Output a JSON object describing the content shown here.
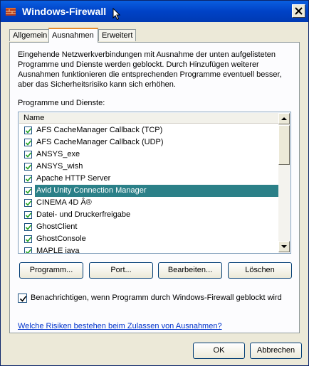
{
  "window": {
    "title": "Windows-Firewall"
  },
  "tabs": [
    {
      "label": "Allgemein"
    },
    {
      "label": "Ausnahmen",
      "active": true
    },
    {
      "label": "Erweitert"
    }
  ],
  "description": "Eingehende Netzwerkverbindungen mit Ausnahme der unten aufgelisteten Programme und Dienste werden geblockt. Durch Hinzufügen weiterer Ausnahmen funktionieren die entsprechenden Programme eventuell besser, aber das Sicherheitsrisiko kann sich erhöhen.",
  "list": {
    "label": "Programme und Dienste:",
    "column_header": "Name",
    "items": [
      {
        "name": "AFS CacheManager Callback (TCP)",
        "checked": true
      },
      {
        "name": "AFS CacheManager Callback (UDP)",
        "checked": true
      },
      {
        "name": "ANSYS_exe",
        "checked": true
      },
      {
        "name": "ANSYS_wish",
        "checked": true
      },
      {
        "name": "Apache HTTP Server",
        "checked": true
      },
      {
        "name": "Avid Unity Connection Manager",
        "checked": true,
        "selected": true
      },
      {
        "name": "CINEMA 4D Â®",
        "checked": true
      },
      {
        "name": "Datei- und Druckerfreigabe",
        "checked": true
      },
      {
        "name": "GhostClient",
        "checked": true
      },
      {
        "name": "GhostConsole",
        "checked": true
      },
      {
        "name": "MAPLE java",
        "checked": true
      }
    ]
  },
  "buttons": {
    "programm": "Programm...",
    "port": "Port...",
    "bearbeiten": "Bearbeiten...",
    "loeschen": "Löschen",
    "ok": "OK",
    "abbrechen": "Abbrechen"
  },
  "notify": {
    "label": "Benachrichtigen, wenn Programm durch Windows-Firewall geblockt wird",
    "checked": true
  },
  "link": "Welche Risiken bestehen beim Zulassen von Ausnahmen?",
  "colors": {
    "titlebar": "#0042c6",
    "selection": "#2b8088",
    "link": "#0033cc"
  }
}
